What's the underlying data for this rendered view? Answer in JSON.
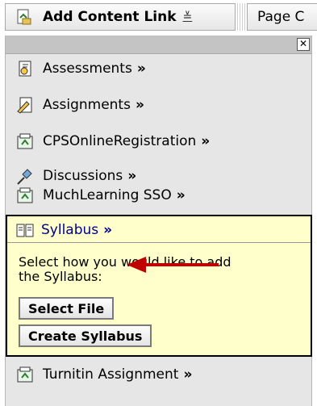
{
  "toolbar": {
    "add_content_label": "Add Content Link",
    "add_content_chevron": "≚",
    "page_label": "Page C"
  },
  "panel": {
    "close_label": "✕",
    "items": [
      {
        "label": "Assessments",
        "icon": "assessment-icon"
      },
      {
        "label": "Assignments",
        "icon": "assignment-icon"
      },
      {
        "label": "CPSOnlineRegistration",
        "icon": "lti-tool-icon"
      },
      {
        "label": "Discussions",
        "icon": "pushpin-icon"
      },
      {
        "label": "MuchLearning SSO",
        "icon": "lti-tool-icon"
      }
    ],
    "more_marker": "»",
    "syllabus": {
      "label": "Syllabus",
      "icon": "syllabus-book-icon",
      "prompt": "Select how you would like to add the Syllabus:",
      "select_file_label": "Select File",
      "create_syllabus_label": "Create Syllabus"
    },
    "after_items": [
      {
        "label": "Turnitin Assignment",
        "icon": "lti-tool-icon"
      }
    ]
  },
  "colors": {
    "panel_bg": "#e6e6e6",
    "highlight_bg": "#ffffcc",
    "annotation_arrow": "#c00000",
    "link_text": "#00008b"
  }
}
